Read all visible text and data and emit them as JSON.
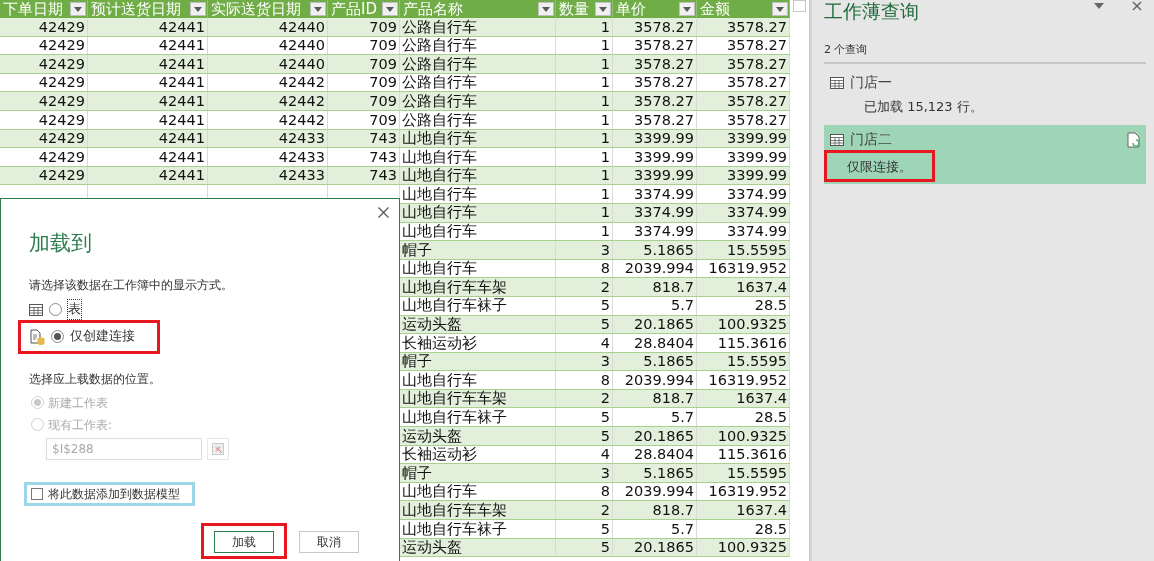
{
  "table": {
    "columns": [
      {
        "label": "下单日期"
      },
      {
        "label": "预计送货日期"
      },
      {
        "label": "实际送货日期"
      },
      {
        "label": "产品ID"
      },
      {
        "label": "产品名称"
      },
      {
        "label": "数量"
      },
      {
        "label": "单价"
      },
      {
        "label": "金额"
      }
    ],
    "rows": [
      {
        "cells": [
          "42429",
          "42441",
          "42440",
          "709",
          "公路自行车",
          "1",
          "3578.27",
          "3578.27"
        ]
      },
      {
        "cells": [
          "42429",
          "42441",
          "42440",
          "709",
          "公路自行车",
          "1",
          "3578.27",
          "3578.27"
        ]
      },
      {
        "cells": [
          "42429",
          "42441",
          "42440",
          "709",
          "公路自行车",
          "1",
          "3578.27",
          "3578.27"
        ]
      },
      {
        "cells": [
          "42429",
          "42441",
          "42442",
          "709",
          "公路自行车",
          "1",
          "3578.27",
          "3578.27"
        ]
      },
      {
        "cells": [
          "42429",
          "42441",
          "42442",
          "709",
          "公路自行车",
          "1",
          "3578.27",
          "3578.27"
        ]
      },
      {
        "cells": [
          "42429",
          "42441",
          "42442",
          "709",
          "公路自行车",
          "1",
          "3578.27",
          "3578.27"
        ]
      },
      {
        "cells": [
          "42429",
          "42441",
          "42433",
          "743",
          "山地自行车",
          "1",
          "3399.99",
          "3399.99"
        ]
      },
      {
        "cells": [
          "42429",
          "42441",
          "42433",
          "743",
          "山地自行车",
          "1",
          "3399.99",
          "3399.99"
        ]
      },
      {
        "cells": [
          "42429",
          "42441",
          "42433",
          "743",
          "山地自行车",
          "1",
          "3399.99",
          "3399.99"
        ]
      },
      {
        "cells": [
          "山地自行车",
          "1",
          "3374.99",
          "3374.99"
        ]
      },
      {
        "cells": [
          "山地自行车",
          "1",
          "3374.99",
          "3374.99"
        ]
      },
      {
        "cells": [
          "山地自行车",
          "1",
          "3374.99",
          "3374.99"
        ]
      },
      {
        "cells": [
          "帽子",
          "3",
          "5.1865",
          "15.5595"
        ]
      },
      {
        "cells": [
          "山地自行车",
          "8",
          "2039.994",
          "16319.952"
        ]
      },
      {
        "cells": [
          "山地自行车车架",
          "2",
          "818.7",
          "1637.4"
        ]
      },
      {
        "cells": [
          "山地自行车袜子",
          "5",
          "5.7",
          "28.5"
        ]
      },
      {
        "cells": [
          "运动头盔",
          "5",
          "20.1865",
          "100.9325"
        ]
      },
      {
        "cells": [
          "长袖运动衫",
          "4",
          "28.8404",
          "115.3616"
        ]
      },
      {
        "cells": [
          "帽子",
          "3",
          "5.1865",
          "15.5595"
        ]
      },
      {
        "cells": [
          "山地自行车",
          "8",
          "2039.994",
          "16319.952"
        ]
      },
      {
        "cells": [
          "山地自行车车架",
          "2",
          "818.7",
          "1637.4"
        ]
      },
      {
        "cells": [
          "山地自行车袜子",
          "5",
          "5.7",
          "28.5"
        ]
      },
      {
        "cells": [
          "运动头盔",
          "5",
          "20.1865",
          "100.9325"
        ]
      },
      {
        "cells": [
          "长袖运动衫",
          "4",
          "28.8404",
          "115.3616"
        ]
      },
      {
        "cells": [
          "帽子",
          "3",
          "5.1865",
          "15.5595"
        ]
      },
      {
        "cells": [
          "山地自行车",
          "8",
          "2039.994",
          "16319.952"
        ]
      },
      {
        "cells": [
          "山地自行车车架",
          "2",
          "818.7",
          "1637.4"
        ]
      },
      {
        "cells": [
          "山地自行车袜子",
          "5",
          "5.7",
          "28.5"
        ]
      },
      {
        "cells": [
          "运动头盔",
          "5",
          "20.1865",
          "100.9325"
        ]
      }
    ]
  },
  "query_pane": {
    "title": "工作薄查询",
    "count": "2 个查询",
    "queries": [
      {
        "name": "门店一",
        "status": "已加载 15,123 行。",
        "selected": false,
        "annotated": false
      },
      {
        "name": "门店二",
        "status": "仅限连接。",
        "selected": true,
        "annotated": true
      }
    ]
  },
  "dialog": {
    "title": "加载到",
    "prompt": "请选择该数据在工作簿中的显示方式。",
    "display_options": [
      {
        "label": "表",
        "kind": "table",
        "selected": false,
        "focused": true,
        "annotated": false
      },
      {
        "label": "仅创建连接",
        "kind": "connection",
        "selected": true,
        "focused": false,
        "annotated": true
      }
    ],
    "location_prompt": "选择应上载数据的位置。",
    "location_options": [
      {
        "label": "新建工作表",
        "selected": true,
        "disabled": true
      },
      {
        "label": "现有工作表:",
        "selected": false,
        "disabled": true
      }
    ],
    "location_field": {
      "value": "$I$288",
      "disabled": true
    },
    "data_model": {
      "label": "将此数据添加到数据模型",
      "checked": false,
      "focused": true
    },
    "buttons": [
      {
        "label": "加载",
        "kind": "primary",
        "annotated": true
      },
      {
        "label": "取消",
        "kind": "secondary",
        "annotated": false
      }
    ]
  }
}
